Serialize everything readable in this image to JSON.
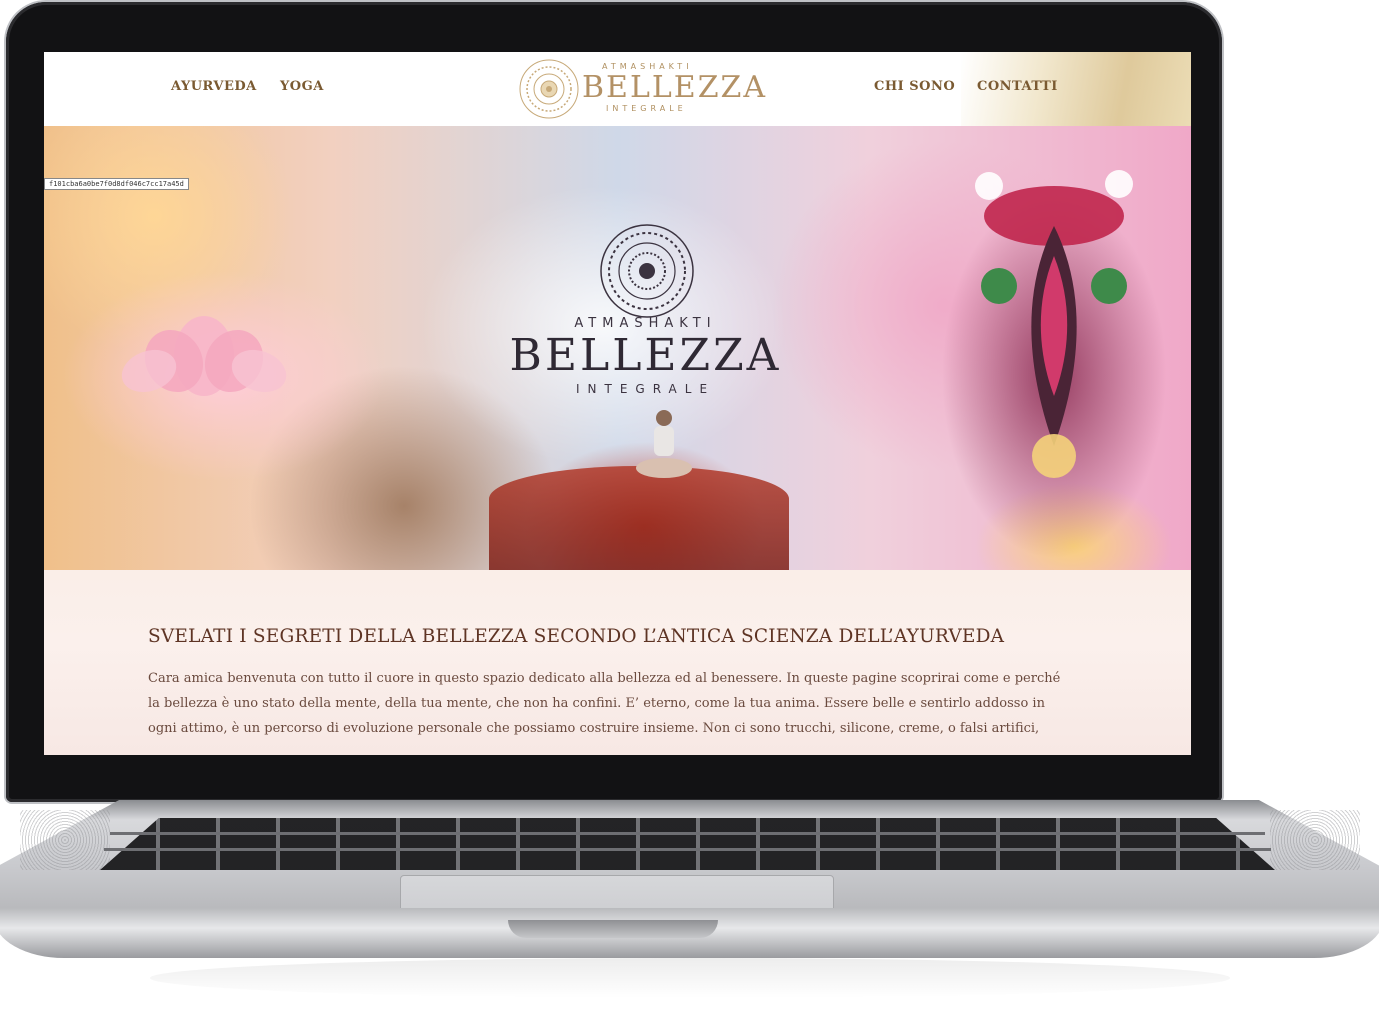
{
  "nav": {
    "left": [
      {
        "label": "AYURVEDA"
      },
      {
        "label": "YOGA"
      }
    ],
    "right": [
      {
        "label": "CHI SONO"
      },
      {
        "label": "CONTATTI"
      }
    ]
  },
  "logo": {
    "top": "ATMASHAKTI",
    "main": "BELLEZZA",
    "bottom": "INTEGRALE"
  },
  "hero": {
    "image_id_label": "f101cba6a0be7f0d8df046c7cc17a45d",
    "brand_top": "ATMASHAKTI",
    "brand_main": "BELLEZZA",
    "brand_bottom": "INTEGRALE"
  },
  "content": {
    "title": "SVELATI I SEGRETI DELLA BELLEZZA SECONDO L’ANTICA SCIENZA DELL’AYURVEDA",
    "lines": [
      "Cara amica benvenuta con tutto il cuore in questo spazio dedicato alla bellezza ed al benessere. In queste pagine scoprirai come e perché",
      "la bellezza è uno stato della mente, della tua mente, che non ha confini. E’ eterno, come la tua anima. Essere belle e sentirlo addosso in",
      "ogni attimo, è un percorso di evoluzione personale che possiamo costruire insieme. Non ci sono trucchi, silicone, creme, o falsi artifici,"
    ]
  },
  "colors": {
    "nav_text": "#7a5a32",
    "title_text": "#5e3424",
    "body_text": "#6a4a3e",
    "gold": "#d9c08a"
  },
  "icons": [
    "mandala-logo-icon",
    "mandala-hero-icon"
  ]
}
